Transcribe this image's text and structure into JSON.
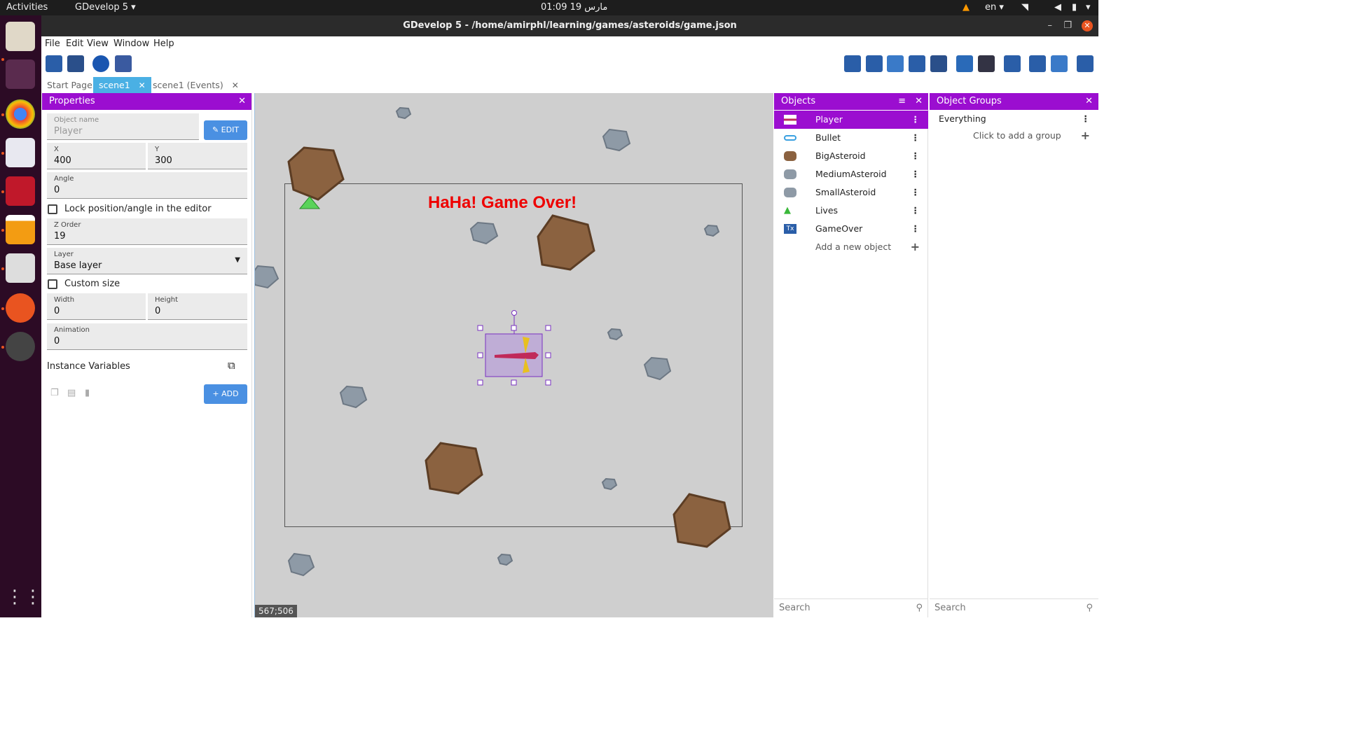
{
  "topbar": {
    "activities": "Activities",
    "app_menu": "GDevelop 5 ▾",
    "clock": "01:09  مارس 19",
    "lang": "en ▾"
  },
  "window": {
    "title": "GDevelop 5 - /home/amirphl/learning/games/asteroids/game.json"
  },
  "menu": [
    "File",
    "Edit",
    "View",
    "Window",
    "Help"
  ],
  "tabs": [
    {
      "label": "Start Page",
      "closable": false
    },
    {
      "label": "scene1",
      "closable": true,
      "active": true
    },
    {
      "label": "scene1 (Events)",
      "closable": true
    }
  ],
  "properties": {
    "title": "Properties",
    "object_name_label": "Object name",
    "object_name_placeholder": "Player",
    "edit_label": "EDIT",
    "x_label": "X",
    "x_value": "400",
    "y_label": "Y",
    "y_value": "300",
    "angle_label": "Angle",
    "angle_value": "0",
    "lock_label": "Lock position/angle in the editor",
    "zorder_label": "Z Order",
    "zorder_value": "19",
    "layer_label": "Layer",
    "layer_value": "Base layer",
    "custom_size_label": "Custom size",
    "width_label": "Width",
    "width_value": "0",
    "height_label": "Height",
    "height_value": "0",
    "animation_label": "Animation",
    "animation_value": "0",
    "instance_vars_label": "Instance Variables",
    "add_label": "ADD"
  },
  "canvas": {
    "game_over_text": "HaHa! Game Over!",
    "cursor_coords": "567;506"
  },
  "objects": {
    "title": "Objects",
    "items": [
      {
        "name": "Player",
        "icon": "ship-icon",
        "selected": true
      },
      {
        "name": "Bullet",
        "icon": "bullet-icon"
      },
      {
        "name": "BigAsteroid",
        "icon": "big-asteroid-icon"
      },
      {
        "name": "MediumAsteroid",
        "icon": "medium-asteroid-icon"
      },
      {
        "name": "SmallAsteroid",
        "icon": "small-asteroid-icon"
      },
      {
        "name": "Lives",
        "icon": "lives-icon"
      },
      {
        "name": "GameOver",
        "icon": "text-object-icon"
      }
    ],
    "add_label": "Add a new object",
    "search_placeholder": "Search"
  },
  "groups": {
    "title": "Object Groups",
    "items": [
      "Everything"
    ],
    "add_label": "Click to add a group",
    "search_placeholder": "Search"
  },
  "colors": {
    "panel_header": "#9b0ed0",
    "tab_active": "#4ab0e4",
    "button_blue": "#4a90e2",
    "canvas_bg": "#cfcfcf",
    "game_over": "#ee0000"
  }
}
